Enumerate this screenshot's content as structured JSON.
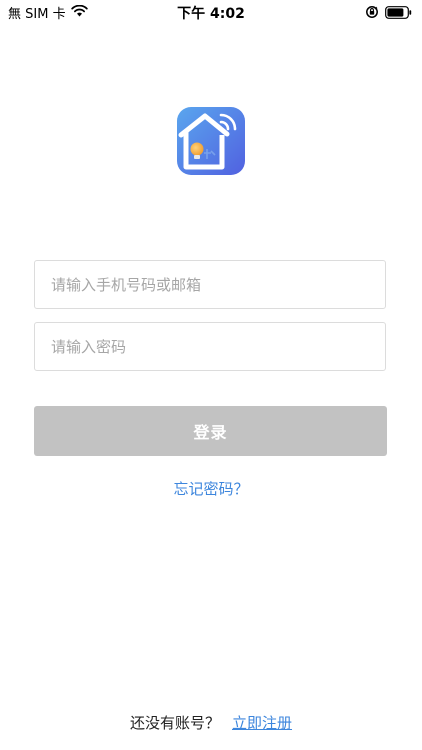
{
  "status_bar": {
    "carrier": "無 SIM 卡",
    "time": "下午 4:02",
    "icons": [
      "wifi-icon",
      "orientation-lock-icon",
      "battery-icon"
    ]
  },
  "app": {
    "logo_icon": "smart-home-logo-icon",
    "colors": {
      "logo_gradient_start": "#5aa6ee",
      "logo_gradient_end": "#5161e0",
      "bulb": "#f2a53a",
      "accent_link": "#3d86dd",
      "button_disabled": "#c2c2c2"
    }
  },
  "login_form": {
    "account_placeholder": "请输入手机号码或邮箱",
    "account_value": "",
    "password_placeholder": "请输入密码",
    "password_value": "",
    "login_label": "登录",
    "forgot_label": "忘记密码？"
  },
  "register": {
    "prompt": "还没有账号？",
    "link_label": "立即注册"
  }
}
